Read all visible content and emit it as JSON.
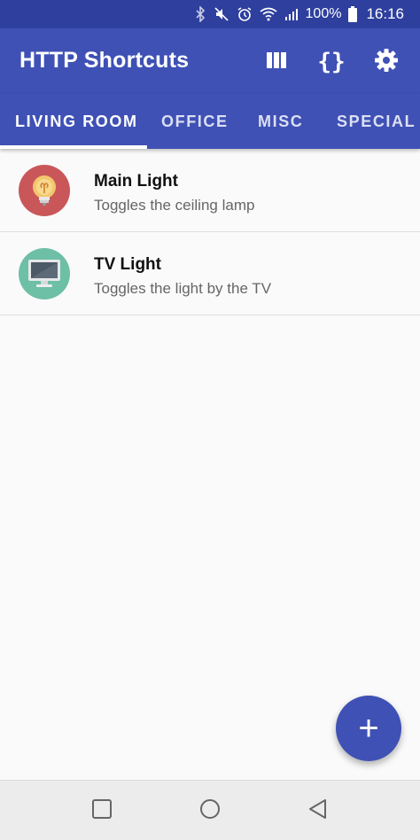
{
  "status": {
    "battery": "100%",
    "time": "16:16"
  },
  "app": {
    "title": "HTTP Shortcuts",
    "actions": [
      "columns-icon",
      "braces-icon",
      "settings-icon"
    ],
    "variables_label": "{}"
  },
  "tabs": [
    {
      "label": "LIVING ROOM",
      "selected": true
    },
    {
      "label": "OFFICE",
      "selected": false
    },
    {
      "label": "MISC",
      "selected": false
    },
    {
      "label": "SPECIAL S",
      "selected": false
    }
  ],
  "shortcuts": [
    {
      "title": "Main Light",
      "description": "Toggles the ceiling lamp",
      "icon": "lightbulb-icon",
      "color": "#c9575a"
    },
    {
      "title": "TV Light",
      "description": "Toggles the light by the TV",
      "icon": "monitor-icon",
      "color": "#6dbfa6"
    }
  ],
  "fab": {
    "label": "+"
  },
  "colors": {
    "primary": "#3f51b5",
    "status": "#2e3f9e",
    "accent": "#ffffff"
  }
}
